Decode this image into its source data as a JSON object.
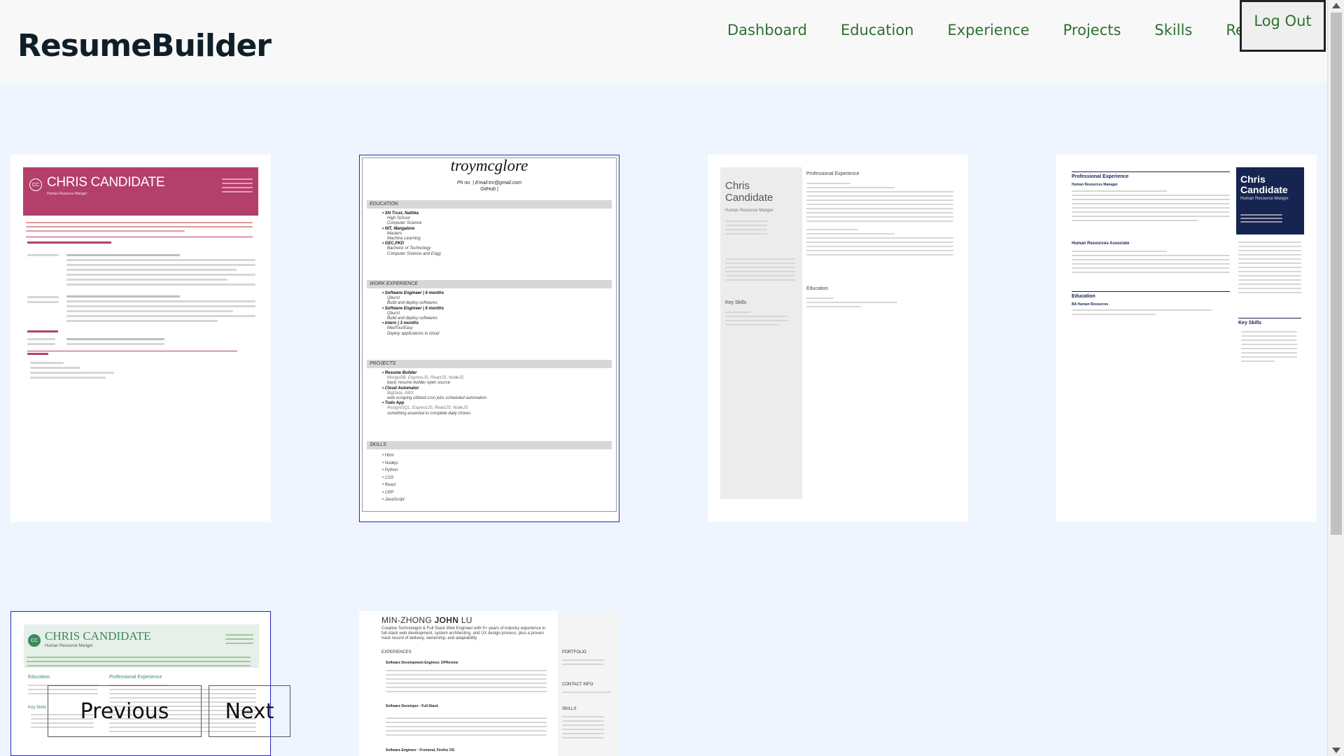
{
  "app": {
    "brand": "ResumeBuilder"
  },
  "nav": {
    "items": [
      {
        "label": "Dashboard"
      },
      {
        "label": "Education"
      },
      {
        "label": "Experience"
      },
      {
        "label": "Projects"
      },
      {
        "label": "Skills"
      },
      {
        "label": "Review"
      }
    ],
    "logout_label": "Log Out"
  },
  "templates": [
    {
      "name": "CHRIS CANDIDATE",
      "role": "Human Resource Manger",
      "initials": "CC",
      "accent": "#b3406b"
    },
    {
      "name": "troymcglore",
      "contact": "Ph no. | Email:trv@gmail.com",
      "github": "GitHub |",
      "sections": {
        "education": "EDUCATION",
        "education_items": [
          {
            "school": "SN Trust, Nattika",
            "l1": "High School",
            "l2": "Computer Science"
          },
          {
            "school": "NIT, Mangalore",
            "l1": "Masters",
            "l2": "Machine Learning"
          },
          {
            "school": "GEC,PKD",
            "l1": "Bachelor of Technology",
            "l2": "Computer Science and Engg"
          }
        ],
        "work": "WORK EXPERIENCE",
        "work_items": [
          {
            "title": "Software Engineer | 6 months",
            "co": "Qburst",
            "desc": "Build and deploy softwares"
          },
          {
            "title": "Software Engineer | 6 months",
            "co": "Qburst",
            "desc": "Build and deploy softwares"
          },
          {
            "title": "Intern | 3 months",
            "co": "MedTourEasy",
            "desc": "Deploy applications in cloud"
          }
        ],
        "projects": "PROJECTS",
        "project_items": [
          {
            "title": "Resume Builder",
            "stack": "MongoDB, ExpressJS, ReactJS, NodeJS",
            "desc": "basic resume builder open source"
          },
          {
            "title": "Cloud Automator",
            "stack": "BigData, AWS",
            "desc": "web scraping utilized cron jobs scheduled automation"
          },
          {
            "title": "Todo App",
            "stack": "PostgreSQL, ExpressJS, ReactJS, NodeJS",
            "desc": "something essential to complete daily chores"
          }
        ],
        "skills": "SKILLS",
        "skill_items": [
          "Html",
          "Nodejs",
          "Python",
          "CSS",
          "React",
          "CPP",
          "JavaScript"
        ]
      }
    },
    {
      "name1": "Chris",
      "name2": "Candidate",
      "role": "Human Resource Manger",
      "pe": "Professional Experience",
      "edu": "Education",
      "ks": "Key Skills"
    },
    {
      "name1": "Chris",
      "name2": "Candidate",
      "role": "Human Resource Manger",
      "pe": "Professional Experience",
      "edu": "Education",
      "ks": "Key Skills",
      "pe_title": "Human Resources Manager",
      "pe_title2": "Human Resources Associate",
      "edu_title": "BA Human Resources",
      "accent": "#152451"
    },
    {
      "name": "CHRIS CANDIDATE",
      "role": "Human Resource Manger",
      "initials": "CC",
      "edu": "Education",
      "pe": "Professional Experience",
      "ks": "Key Skills",
      "accent": "#3a8a5a"
    },
    {
      "name_first": "MIN-ZHONG ",
      "name_bold": "JOHN",
      "name_last": " LU",
      "summary": "Creative Technologist & Full Stack Web Engineer with 5+ years of industry experience in full-stack web development, system architecting, and UX design process, plus a proven track record of delivery, ownership, and adaptability",
      "exp": "EXPERIENCES",
      "jobs": [
        "Software Development Engineer, DPReview",
        "Software Developer - Full-Stack",
        "Software Engineer - Frontend, Firefox OS"
      ],
      "side": [
        "PORTFOLIO",
        "CONTACT INFO",
        "SKILLS"
      ]
    }
  ],
  "pager": {
    "previous": "Previous",
    "next": "Next"
  }
}
